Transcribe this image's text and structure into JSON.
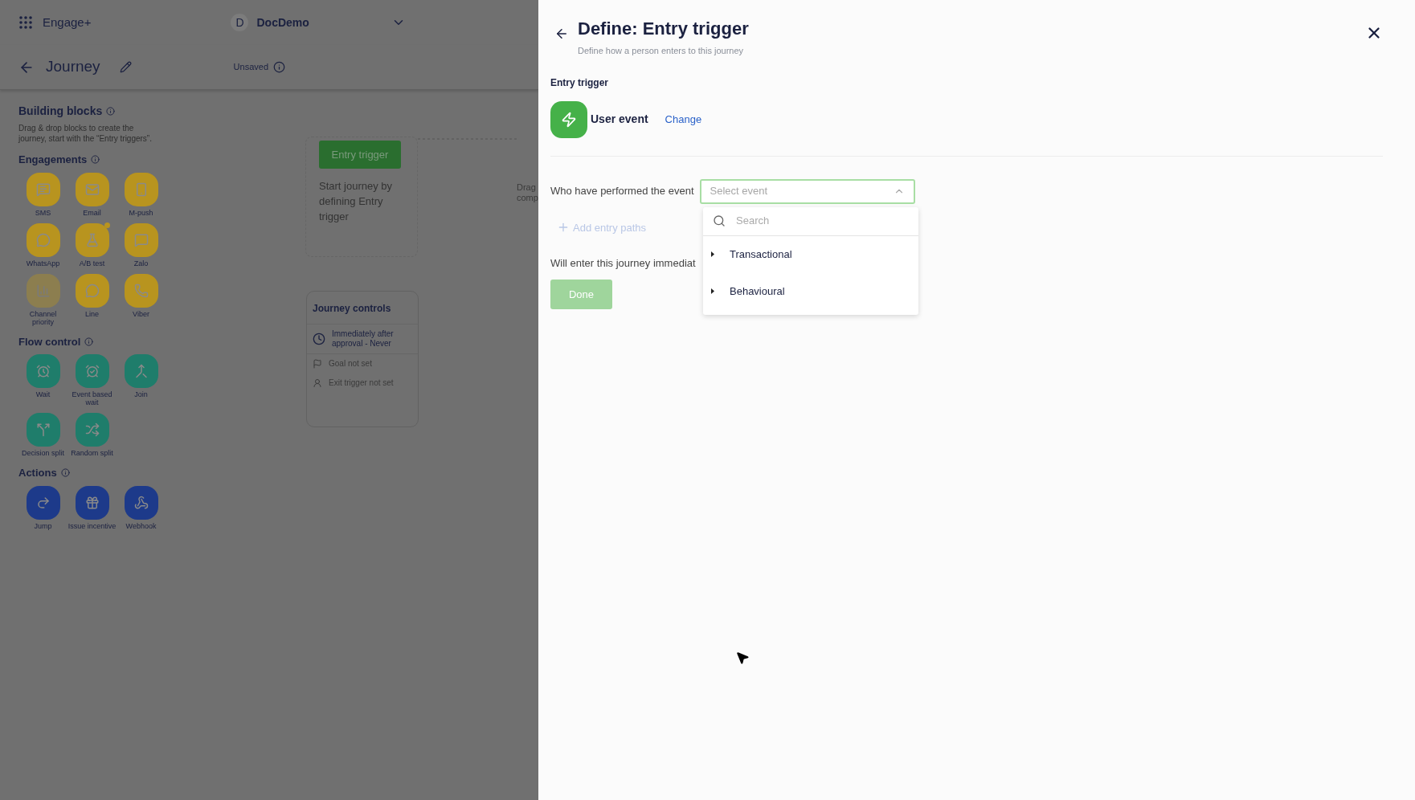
{
  "app_bar": {
    "app_name": "Engage+",
    "workspace": {
      "initial": "D",
      "name": "DocDemo"
    }
  },
  "journey_header": {
    "title": "Journey",
    "status": "Unsaved"
  },
  "building_blocks": {
    "title": "Building blocks",
    "description": "Drag & drop blocks to create the journey, start with the “Entry triggers”.",
    "sections": [
      {
        "title": "Engagements",
        "color": "#b8941f",
        "items": [
          {
            "label": "SMS",
            "kind": "sms",
            "disabled": false,
            "badge_dot": false
          },
          {
            "label": "Email",
            "kind": "email",
            "disabled": false,
            "badge_dot": false
          },
          {
            "label": "M-push",
            "kind": "mpush",
            "disabled": false,
            "badge_dot": false
          },
          {
            "label": "WhatsApp",
            "kind": "whatsapp",
            "disabled": false,
            "badge_dot": false
          },
          {
            "label": "A/B test",
            "kind": "abtest",
            "disabled": false,
            "badge_dot": true
          },
          {
            "label": "Zalo",
            "kind": "zalo",
            "disabled": false,
            "badge_dot": false
          },
          {
            "label": "Channel priority",
            "kind": "priority",
            "disabled": true,
            "badge_dot": false
          },
          {
            "label": "Line",
            "kind": "line",
            "disabled": false,
            "badge_dot": false
          },
          {
            "label": "Viber",
            "kind": "viber",
            "disabled": false,
            "badge_dot": false
          }
        ]
      },
      {
        "title": "Flow control",
        "color": "#1f7d6b",
        "items": [
          {
            "label": "Wait",
            "kind": "wait",
            "disabled": false,
            "badge_dot": false
          },
          {
            "label": "Event based wait",
            "kind": "eventwait",
            "disabled": false,
            "badge_dot": false
          },
          {
            "label": "Join",
            "kind": "join",
            "disabled": false,
            "badge_dot": false
          },
          {
            "label": "Decision split",
            "kind": "decision",
            "disabled": false,
            "badge_dot": false
          },
          {
            "label": "Random split",
            "kind": "random",
            "disabled": false,
            "badge_dot": false
          }
        ]
      },
      {
        "title": "Actions",
        "color": "#1d3a8a",
        "items": [
          {
            "label": "Jump",
            "kind": "jump",
            "disabled": false,
            "badge_dot": false
          },
          {
            "label": "Issue incentive",
            "kind": "incentive",
            "disabled": false,
            "badge_dot": false
          },
          {
            "label": "Webhook",
            "kind": "webhook",
            "disabled": false,
            "badge_dot": false
          }
        ]
      }
    ]
  },
  "canvas": {
    "entry_node": {
      "button": "Entry trigger",
      "text": "Start journey by defining Entry trigger"
    },
    "hint_lines": [
      "Drag",
      "comp"
    ],
    "journey_controls": {
      "title": "Journey controls",
      "items": [
        {
          "kind": "schedule",
          "text": "Immediately after approval - Never"
        },
        {
          "kind": "goal",
          "text": "Goal not set"
        },
        {
          "kind": "exit",
          "text": "Exit trigger not set"
        }
      ]
    }
  },
  "drawer": {
    "title": "Define: Entry trigger",
    "subtitle": "Define how a person enters to this journey",
    "section_label": "Entry trigger",
    "trigger": {
      "name": "User event",
      "change_link": "Change"
    },
    "event_field": {
      "label": "Who have performed the event",
      "placeholder": "Select event",
      "expanded": true,
      "dropdown": {
        "search_placeholder": "Search",
        "options": [
          {
            "label": "Transactional",
            "expanded": false
          },
          {
            "label": "Behavioural",
            "expanded": false
          }
        ]
      }
    },
    "add_entry_paths": "Add entry paths",
    "note": "Will enter this journey immediat",
    "done_button": {
      "label": "Done",
      "disabled": true
    }
  }
}
